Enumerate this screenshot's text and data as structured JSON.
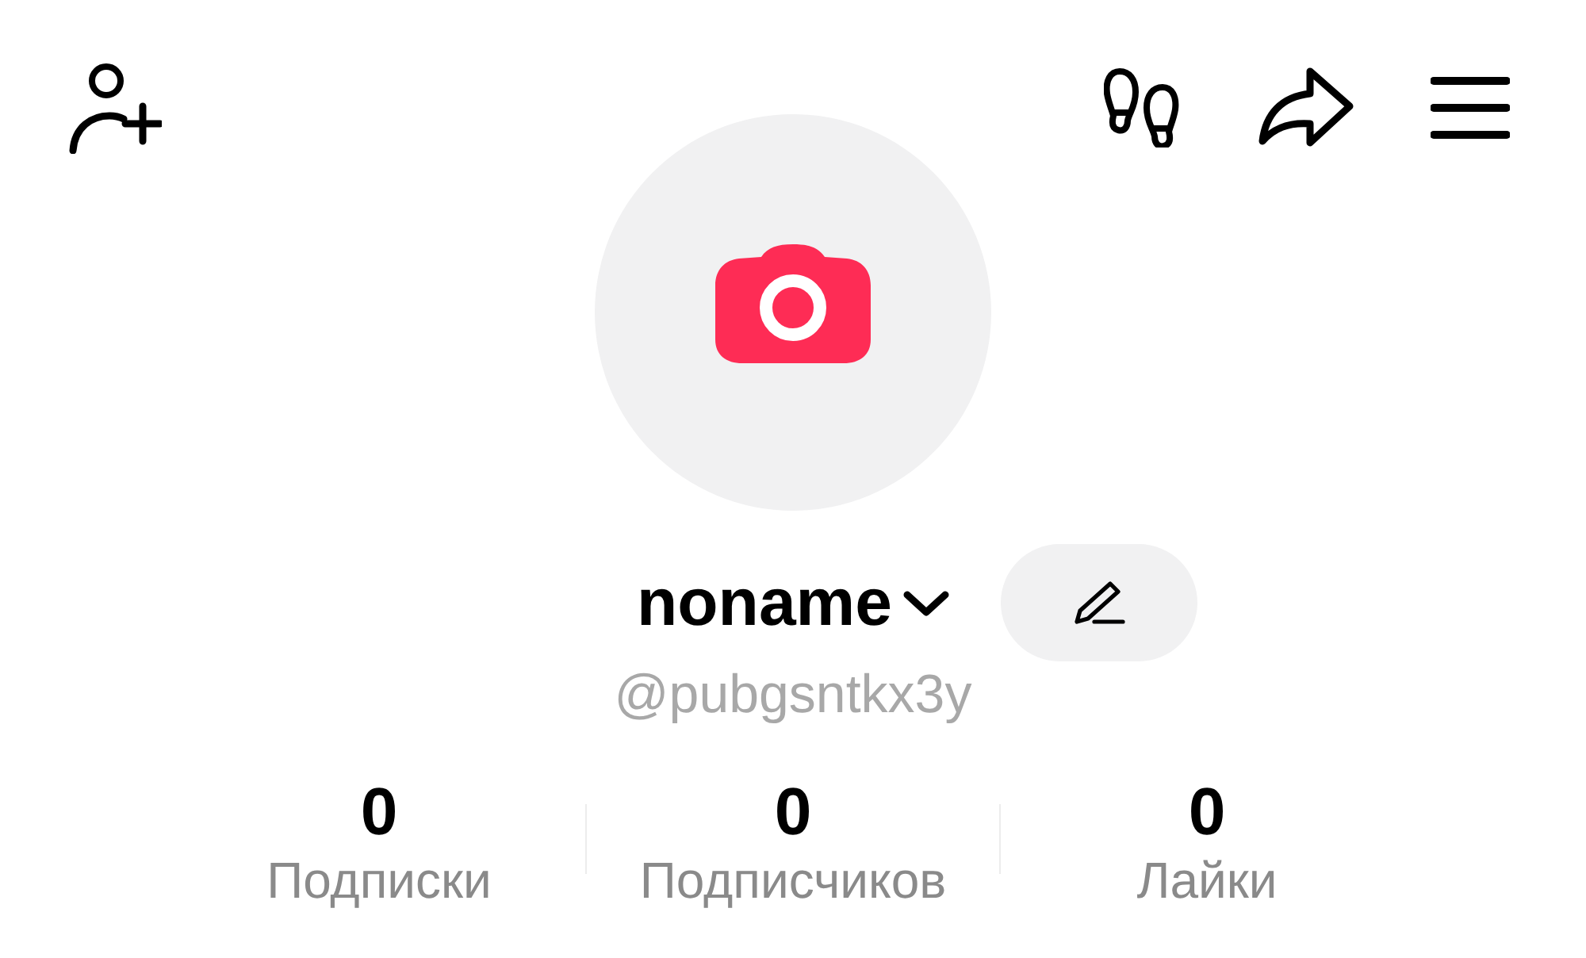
{
  "profile": {
    "display_name": "noname",
    "handle": "@pubgsntkx3y"
  },
  "stats": [
    {
      "value": "0",
      "label": "Подписки"
    },
    {
      "value": "0",
      "label": "Подписчиков"
    },
    {
      "value": "0",
      "label": "Лайки"
    }
  ]
}
